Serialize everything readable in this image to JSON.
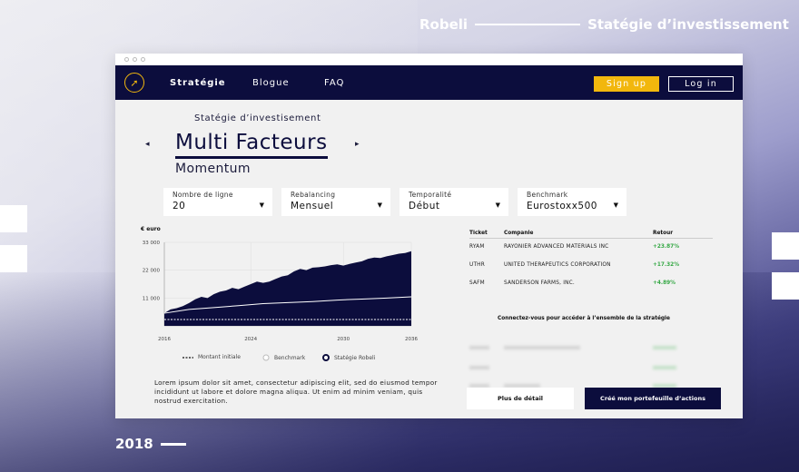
{
  "brand": {
    "name": "Robeli",
    "section": "Statégie d’investissement"
  },
  "year": "2018",
  "nav": {
    "items": [
      "Stratégie",
      "Blogue",
      "FAQ"
    ],
    "signup": "Sign up",
    "login": "Log in"
  },
  "hero": {
    "subtitle": "Statégie d’investisement",
    "title": "Multi Facteurs",
    "factor": "Momentum",
    "prev_arrow": "◂",
    "next_arrow": "▸"
  },
  "filters": [
    {
      "label": "Nombre de ligne",
      "value": "20"
    },
    {
      "label": "Rebalancing",
      "value": "Mensuel"
    },
    {
      "label": "Temporalité",
      "value": "Début"
    },
    {
      "label": "Benchmark",
      "value": "Eurostoxx500"
    }
  ],
  "chart_data": {
    "type": "area",
    "ylabel": "€ euro",
    "yticks": [
      "33 000",
      "22 000",
      "11 000"
    ],
    "xticks": [
      "2016",
      "2024",
      "2030",
      "2036"
    ],
    "ylim": [
      0,
      33000
    ],
    "grid": true,
    "series": [
      {
        "name": "Stratégie Robeli",
        "x": [
          0,
          1,
          2,
          3,
          4,
          5,
          6,
          7,
          8,
          9,
          10,
          11,
          12,
          13,
          14,
          15,
          16,
          17,
          18,
          19,
          20,
          21,
          22,
          23,
          24,
          25,
          26,
          27,
          28,
          29,
          30,
          31,
          32,
          33,
          34,
          35,
          36,
          37,
          38,
          39,
          40
        ],
        "values": [
          5000,
          6500,
          7000,
          7800,
          9000,
          10500,
          11500,
          11000,
          12500,
          13500,
          14000,
          15000,
          14500,
          15500,
          16500,
          17500,
          17000,
          17500,
          18500,
          19500,
          20000,
          21500,
          22500,
          22000,
          23000,
          23200,
          23500,
          24000,
          24300,
          23800,
          24500,
          25000,
          25500,
          26500,
          27000,
          26800,
          27500,
          28000,
          28500,
          28800,
          29500
        ]
      },
      {
        "name": "Benchmark",
        "x": [
          0,
          4,
          8,
          12,
          16,
          20,
          24,
          28,
          32,
          36,
          40
        ],
        "values": [
          5000,
          6500,
          7200,
          8000,
          8800,
          9200,
          9600,
          10200,
          10600,
          11000,
          11500
        ]
      },
      {
        "name": "Montant initiale",
        "x": [
          0,
          40
        ],
        "values": [
          2500,
          2500
        ]
      }
    ]
  },
  "legend": [
    "Montant initiale",
    "Benchmark",
    "Statégie Robeli"
  ],
  "table": {
    "headers": [
      "Ticket",
      "Companie",
      "Retour"
    ],
    "rows": [
      {
        "ticker": "RYAM",
        "company": "RAYONIER ADVANCED MATERIALS INC",
        "ret": "+23.87%"
      },
      {
        "ticker": "UTHR",
        "company": "UNITED THERAPEUTICS CORPORATION",
        "ret": "+17.32%"
      },
      {
        "ticker": "SAFM",
        "company": "SANDERSON FARMS, INC.",
        "ret": "+4.89%"
      }
    ],
    "locked_message": "Connectez-vous pour accéder à l’ensemble de la stratégie"
  },
  "lorem": "Lorem ipsum dolor sit amet, consectetur adipiscing elit, sed do eiusmod tempor incididunt ut labore et dolore magna aliqua. Ut enim ad minim veniam, quis nostrud exercitation.",
  "buttons": {
    "details": "Plus de détail",
    "create": "Créé mon portefeuille d’actions"
  },
  "colors": {
    "navy": "#0c0d3d",
    "accent": "#f2b70d",
    "positive": "#35a845"
  }
}
